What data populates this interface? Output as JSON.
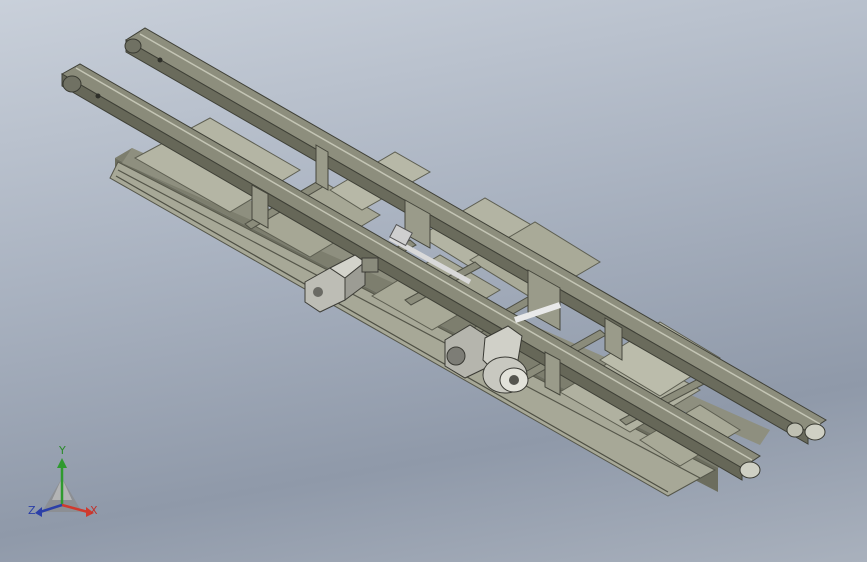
{
  "view": {
    "description_none": "",
    "colors": {
      "frame_dark": "#55564a",
      "frame_mid": "#8d8d7c",
      "frame_light": "#b8b8a6",
      "panel": "#9c9d8d",
      "panel_light": "#c4c5b6",
      "motor": "#c9c9c1",
      "shaft": "#e6e6e6"
    }
  },
  "triad": {
    "x_label": "X",
    "y_label": "Y",
    "z_label": "Z",
    "x_color": "#d03a2e",
    "y_color": "#2f9a2f",
    "z_color": "#2b3fa8"
  }
}
